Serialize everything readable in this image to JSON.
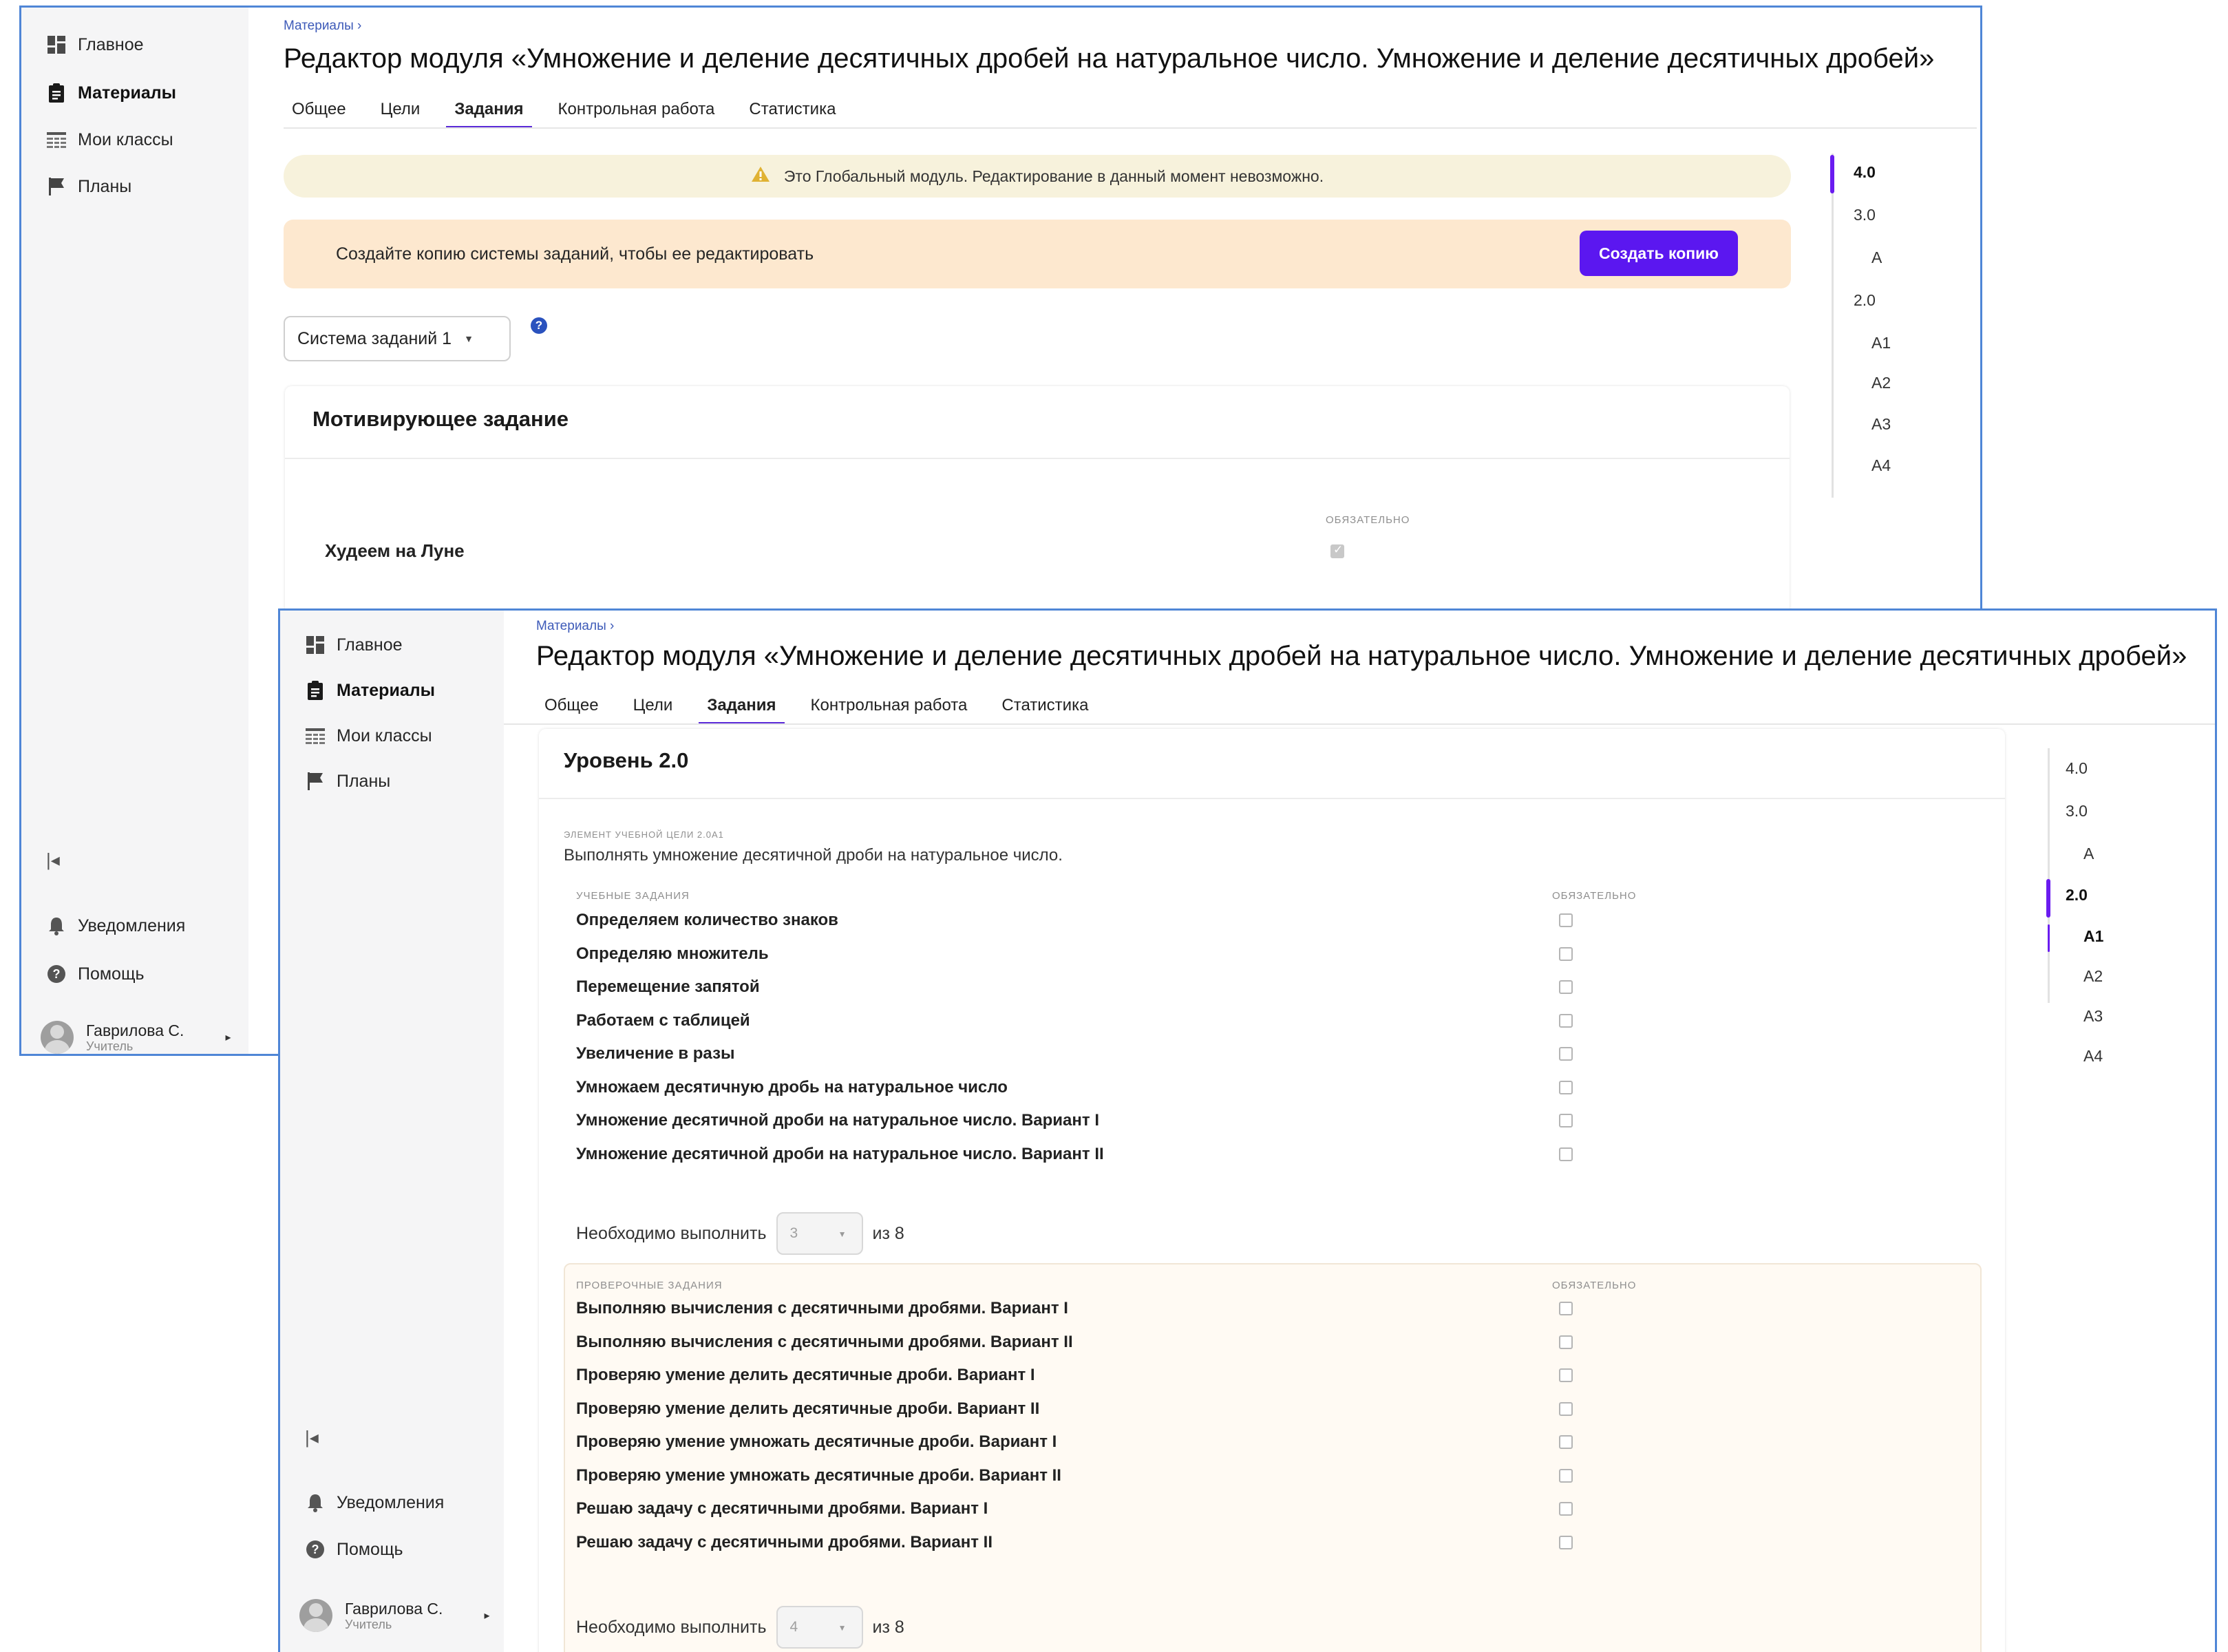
{
  "nav": {
    "home": "Главное",
    "materials": "Материалы",
    "classes": "Мои классы",
    "plans": "Планы",
    "notifications": "Уведомления",
    "help": "Помощь",
    "user_name": "Гаврилова С.",
    "user_role": "Учитель"
  },
  "header": {
    "breadcrumb": "Материалы ›",
    "title": "Редактор модуля «Умножение и деление десятичных дробей на натуральное число. Умножение и деление десятичных дробей»",
    "tabs": [
      "Общее",
      "Цели",
      "Задания",
      "Контрольная работа",
      "Статистика"
    ],
    "active_tab": "Задания"
  },
  "window1": {
    "warning": "Это Глобальный модуль. Редактирование в данный момент невозможно.",
    "copy_notice": "Создайте копию системы заданий, чтобы ее редактировать",
    "copy_button": "Создать копию",
    "system_select": "Система заданий 1",
    "help_icon_text": "?",
    "card_title": "Мотивирующее задание",
    "required_label": "ОБЯЗАТЕЛЬНО",
    "task_name": "Худеем на Луне",
    "task_required": true,
    "levels": [
      "4.0",
      "3.0",
      "A",
      "2.0",
      "A1",
      "A2",
      "A3",
      "A4"
    ],
    "active_level": "4.0"
  },
  "window2": {
    "level_title": "Уровень 2.0",
    "goal_element_label": "ЭЛЕМЕНТ УЧЕБНОЙ ЦЕЛИ 2.0А1",
    "goal_element_text": "Выполнять умножение десятичной дроби на натуральное число.",
    "learning_label": "УЧЕБНЫЕ ЗАДАНИЯ",
    "required_label": "ОБЯЗАТЕЛЬНО",
    "learning_tasks": [
      "Определяем количество знаков",
      "Определяю множитель",
      "Перемещение запятой",
      "Работаем с таблицей",
      "Увеличение в разы",
      "Умножаем десятичную дробь на натуральное число",
      "Умножение десятичной дроби на натуральное число. Вариант I",
      "Умножение десятичной дроби на натуральное число. Вариант II"
    ],
    "need_label": "Необходимо выполнить",
    "learning_need": "3",
    "learning_of": "из 8",
    "verify_label": "ПРОВЕРОЧНЫЕ ЗАДАНИЯ",
    "verify_tasks": [
      "Выполняю вычисления с десятичными дробями. Вариант I",
      "Выполняю вычисления с десятичными дробями. Вариант II",
      "Проверяю умение делить десятичные дроби. Вариант I",
      "Проверяю умение делить десятичные дроби. Вариант II",
      "Проверяю умение умножать десятичные дроби. Вариант I",
      "Проверяю умение умножать десятичные дроби. Вариант II",
      "Решаю задачу с десятичными дробями. Вариант I",
      "Решаю задачу с десятичными дробями. Вариант II"
    ],
    "verify_need": "4",
    "verify_of": "из 8",
    "levels": [
      "4.0",
      "3.0",
      "A",
      "2.0",
      "A1",
      "A2",
      "A3",
      "A4"
    ],
    "active_level": "2.0",
    "active_sublevel": "A1"
  },
  "colors": {
    "accent": "#5b17f0",
    "link": "#3d5ab8",
    "warning_bg": "#f7f2dc",
    "notice_bg": "#fde8cf",
    "verify_bg": "#fffaf3"
  }
}
